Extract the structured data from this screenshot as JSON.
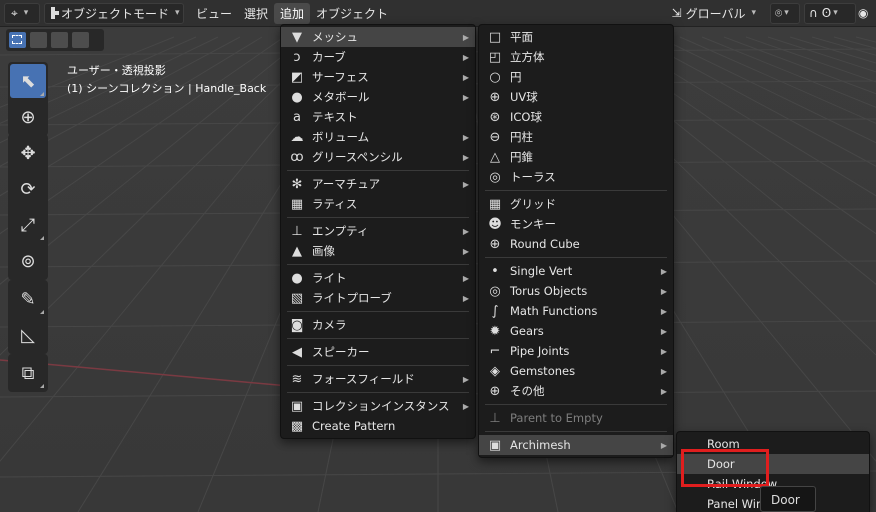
{
  "header": {
    "mode": "オブジェクトモード",
    "menus": [
      "ビュー",
      "選択",
      "追加",
      "オブジェクト"
    ],
    "orientation": "グローバル"
  },
  "viewport": {
    "view_name": "ユーザー・透視投影",
    "collection_info": "(1) シーンコレクション | Handle_Back"
  },
  "add_menu": [
    {
      "label": "メッシュ",
      "icon": "mesh-icon",
      "glyph": "▼",
      "submenu": true,
      "highlighted": true
    },
    {
      "label": "カーブ",
      "icon": "curve-icon",
      "glyph": "ↄ",
      "submenu": true
    },
    {
      "label": "サーフェス",
      "icon": "surface-icon",
      "glyph": "◩",
      "submenu": true
    },
    {
      "label": "メタボール",
      "icon": "metaball-icon",
      "glyph": "●",
      "submenu": true
    },
    {
      "label": "テキスト",
      "icon": "text-icon",
      "glyph": "a",
      "submenu": false
    },
    {
      "label": "ボリューム",
      "icon": "volume-icon",
      "glyph": "☁",
      "submenu": true
    },
    {
      "label": "グリースペンシル",
      "icon": "grease-pencil-icon",
      "glyph": "ꝏ",
      "submenu": true
    },
    {
      "sep": true
    },
    {
      "label": "アーマチュア",
      "icon": "armature-icon",
      "glyph": "✻",
      "submenu": true
    },
    {
      "label": "ラティス",
      "icon": "lattice-icon",
      "glyph": "▦",
      "submenu": false
    },
    {
      "sep": true
    },
    {
      "label": "エンプティ",
      "icon": "empty-icon",
      "glyph": "⊥",
      "submenu": true
    },
    {
      "label": "画像",
      "icon": "image-icon",
      "glyph": "▲",
      "submenu": true
    },
    {
      "sep": true
    },
    {
      "label": "ライト",
      "icon": "light-icon",
      "glyph": "●",
      "submenu": true
    },
    {
      "label": "ライトプローブ",
      "icon": "light-probe-icon",
      "glyph": "▧",
      "submenu": true
    },
    {
      "sep": true
    },
    {
      "label": "カメラ",
      "icon": "camera-icon",
      "glyph": "◙",
      "submenu": false
    },
    {
      "sep": true
    },
    {
      "label": "スピーカー",
      "icon": "speaker-icon",
      "glyph": "◀",
      "submenu": false
    },
    {
      "sep": true
    },
    {
      "label": "フォースフィールド",
      "icon": "force-field-icon",
      "glyph": "≋",
      "submenu": true
    },
    {
      "sep": true
    },
    {
      "label": "コレクションインスタンス",
      "icon": "collection-instance-icon",
      "glyph": "▣",
      "submenu": true
    },
    {
      "label": "Create Pattern",
      "icon": "pattern-icon",
      "glyph": "▩",
      "submenu": false
    }
  ],
  "mesh_menu": [
    {
      "label": "平面",
      "icon": "plane-icon",
      "glyph": "□"
    },
    {
      "label": "立方体",
      "icon": "cube-icon",
      "glyph": "◰"
    },
    {
      "label": "円",
      "icon": "circle-icon",
      "glyph": "○"
    },
    {
      "label": "UV球",
      "icon": "uv-sphere-icon",
      "glyph": "⊕"
    },
    {
      "label": "ICO球",
      "icon": "ico-sphere-icon",
      "glyph": "⊛"
    },
    {
      "label": "円柱",
      "icon": "cylinder-icon",
      "glyph": "⊖"
    },
    {
      "label": "円錐",
      "icon": "cone-icon",
      "glyph": "△"
    },
    {
      "label": "トーラス",
      "icon": "torus-icon",
      "glyph": "◎"
    },
    {
      "sep": true
    },
    {
      "label": "グリッド",
      "icon": "grid-icon",
      "glyph": "▦"
    },
    {
      "label": "モンキー",
      "icon": "monkey-icon",
      "glyph": "☻"
    },
    {
      "label": "Round Cube",
      "icon": "round-cube-icon",
      "glyph": "⊕"
    },
    {
      "sep": true
    },
    {
      "label": "Single Vert",
      "icon": "vertex-icon",
      "glyph": "•",
      "submenu": true
    },
    {
      "label": "Torus Objects",
      "icon": "torus-objects-icon",
      "glyph": "◎",
      "submenu": true
    },
    {
      "label": "Math Functions",
      "icon": "math-functions-icon",
      "glyph": "∫",
      "submenu": true
    },
    {
      "label": "Gears",
      "icon": "gears-icon",
      "glyph": "✹",
      "submenu": true
    },
    {
      "label": "Pipe Joints",
      "icon": "pipe-joints-icon",
      "glyph": "⌐",
      "submenu": true
    },
    {
      "label": "Gemstones",
      "icon": "gemstones-icon",
      "glyph": "◈",
      "submenu": true
    },
    {
      "label": "その他",
      "icon": "misc-icon",
      "glyph": "⊕",
      "submenu": true
    },
    {
      "sep": true
    },
    {
      "label": "Parent to Empty",
      "icon": "parent-empty-icon",
      "glyph": "⊥",
      "dim": true
    },
    {
      "sep": true
    },
    {
      "label": "Archimesh",
      "icon": "archimesh-icon",
      "glyph": "▣",
      "submenu": true,
      "highlighted": true
    }
  ],
  "archimesh_menu": [
    {
      "label": "Room"
    },
    {
      "label": "Door",
      "highlighted": true
    },
    {
      "label": "Rail Window"
    },
    {
      "label": "Panel Window"
    }
  ],
  "tooltip": "Door",
  "colors": {
    "accent": "#4772b3",
    "menu_bg": "#1c1c1c",
    "highlight": "#454545",
    "annotation_red": "#e01e1e"
  }
}
